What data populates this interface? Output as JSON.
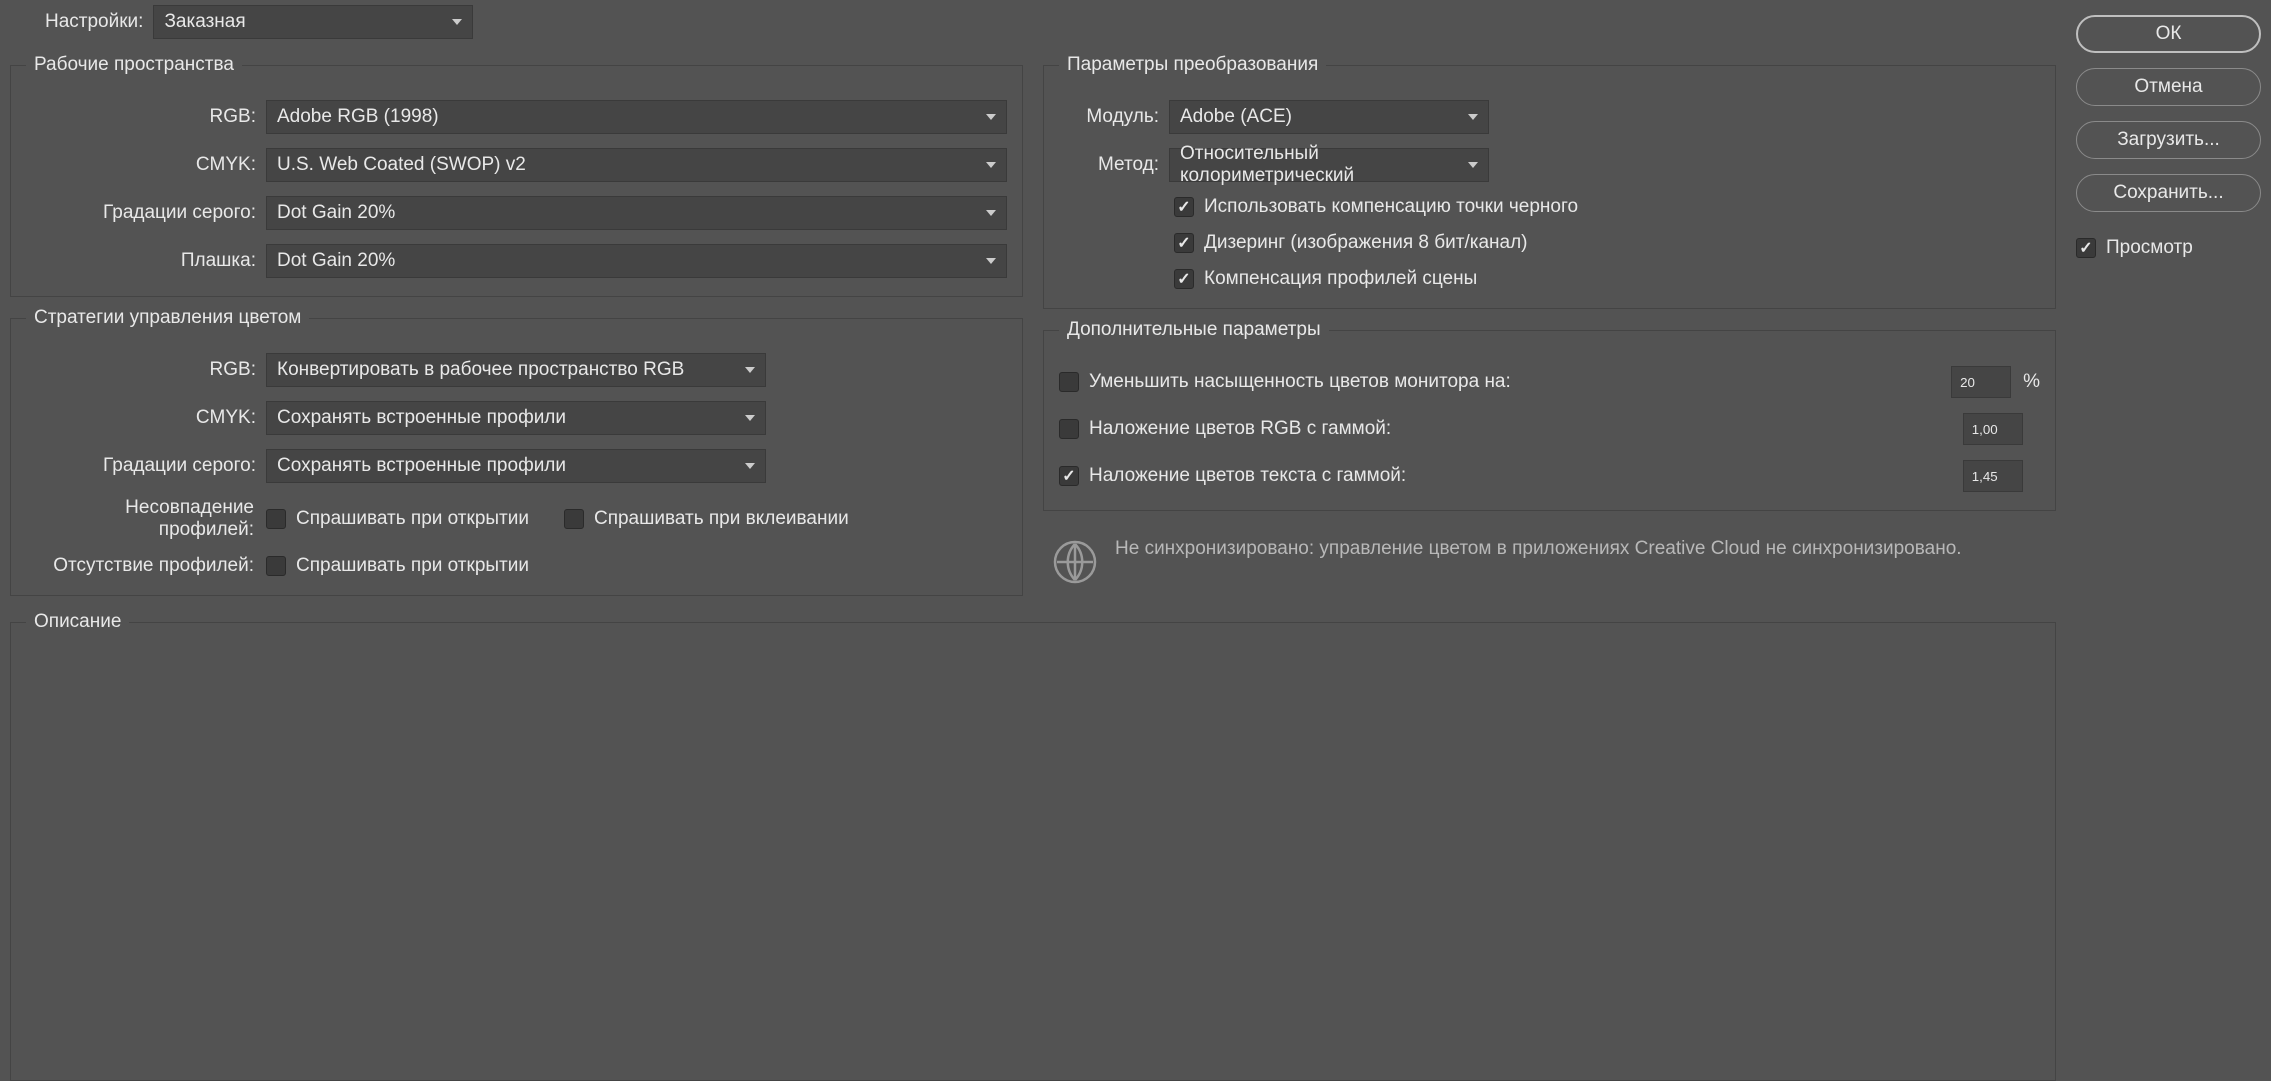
{
  "top": {
    "settings_label": "Настройки:",
    "settings_value": "Заказная"
  },
  "workspaces": {
    "legend": "Рабочие пространства",
    "rgb_label": "RGB:",
    "rgb_value": "Adobe RGB (1998)",
    "cmyk_label": "CMYK:",
    "cmyk_value": "U.S. Web Coated (SWOP) v2",
    "gray_label": "Градации серого:",
    "gray_value": "Dot Gain 20%",
    "spot_label": "Плашка:",
    "spot_value": "Dot Gain 20%"
  },
  "policies": {
    "legend": "Стратегии управления цветом",
    "rgb_label": "RGB:",
    "rgb_value": "Конвертировать в рабочее пространство RGB",
    "cmyk_label": "CMYK:",
    "cmyk_value": "Сохранять встроенные профили",
    "gray_label": "Градации серого:",
    "gray_value": "Сохранять встроенные профили",
    "mismatch_label": "Несовпадение профилей:",
    "mismatch_open": "Спрашивать при открытии",
    "mismatch_paste": "Спрашивать при вклеивании",
    "missing_label": "Отсутствие профилей:",
    "missing_open": "Спрашивать при открытии"
  },
  "conversion": {
    "legend": "Параметры преобразования",
    "engine_label": "Модуль:",
    "engine_value": "Adobe (ACE)",
    "intent_label": "Метод:",
    "intent_value": "Относительный колориметрический",
    "bpc": "Использовать компенсацию точки черного",
    "dither": "Дизеринг (изображения 8 бит/канал)",
    "scene": "Компенсация профилей сцены"
  },
  "advanced": {
    "legend": "Дополнительные параметры",
    "desat_label": "Уменьшить насыщенность цветов монитора на:",
    "desat_value": "20",
    "pct": "%",
    "blend_rgb_label": "Наложение цветов RGB с гаммой:",
    "blend_rgb_value": "1,00",
    "blend_text_label": "Наложение цветов текста с гаммой:",
    "blend_text_value": "1,45"
  },
  "sync": {
    "text": "Не синхронизировано: управление цветом в приложениях Creative Cloud не синхронизировано."
  },
  "description": {
    "legend": "Описание"
  },
  "buttons": {
    "ok": "ОК",
    "cancel": "Отмена",
    "load": "Загрузить...",
    "save": "Сохранить...",
    "preview": "Просмотр"
  }
}
